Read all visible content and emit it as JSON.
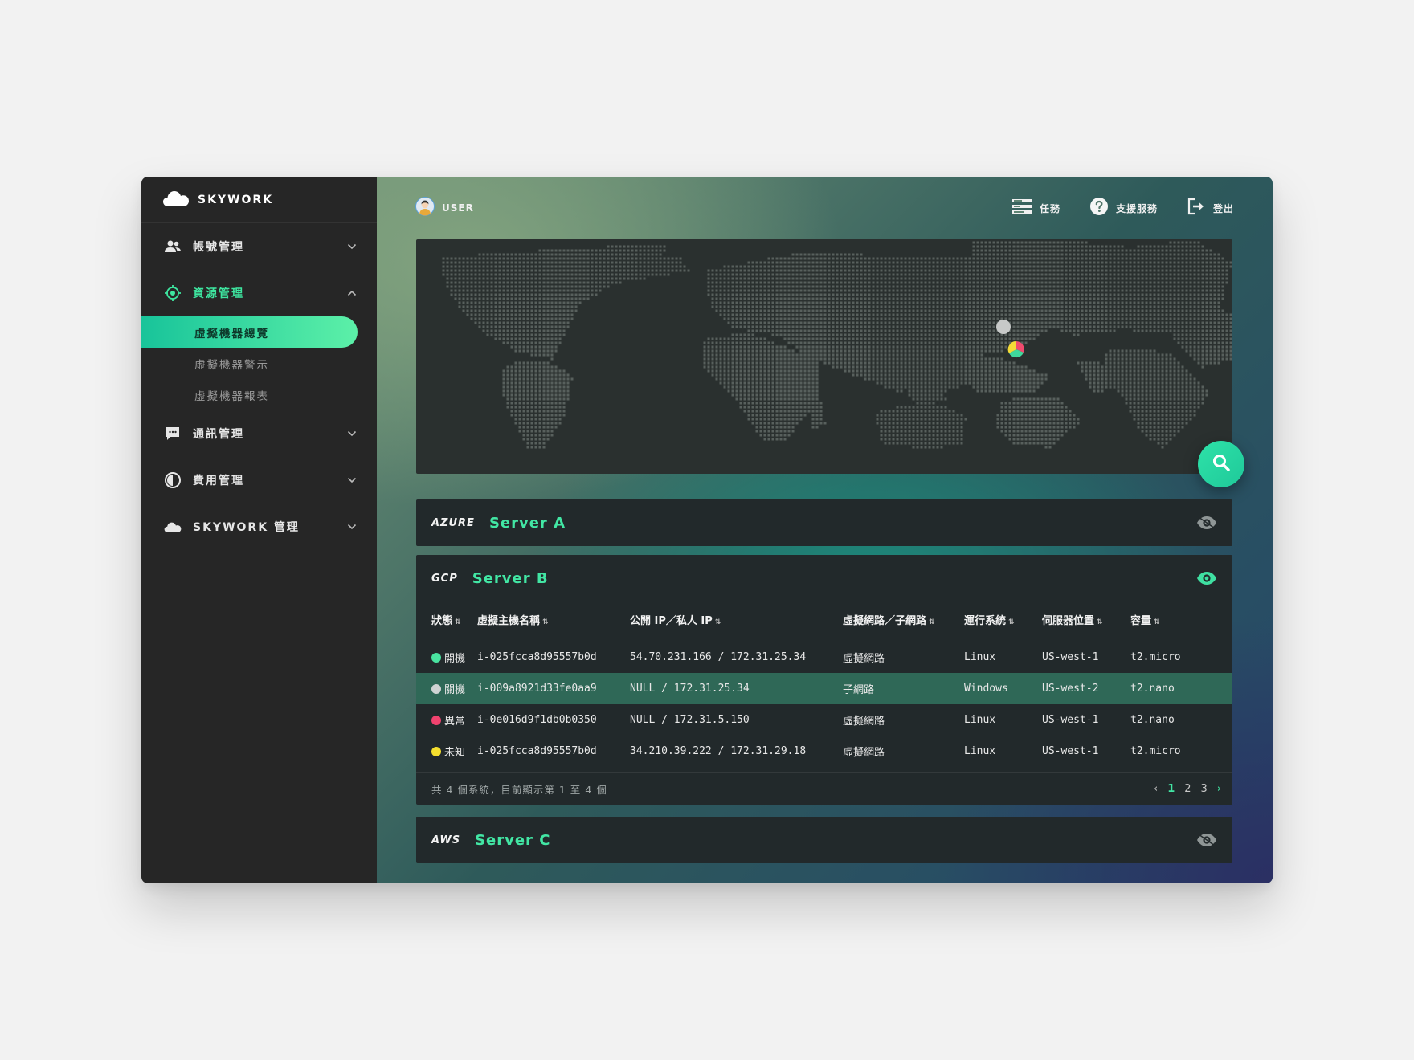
{
  "brand": {
    "name": "SKYWORK"
  },
  "sidebar": {
    "groups": [
      {
        "label": "帳號管理",
        "icon": "users-icon",
        "expanded": false
      },
      {
        "label": "資源管理",
        "icon": "target-icon",
        "expanded": true,
        "items": [
          {
            "label": "虛擬機器總覽",
            "active": true
          },
          {
            "label": "虛擬機器警示",
            "active": false
          },
          {
            "label": "虛擬機器報表",
            "active": false
          }
        ]
      },
      {
        "label": "通訊管理",
        "icon": "chat-icon",
        "expanded": false
      },
      {
        "label": "費用管理",
        "icon": "billing-icon",
        "expanded": false
      },
      {
        "label": "SKYWORK 管理",
        "icon": "cloud-icon",
        "expanded": false
      }
    ]
  },
  "topbar": {
    "user": "USER",
    "tasks": "任務",
    "support": "支援服務",
    "logout": "登出"
  },
  "servers": [
    {
      "provider": "AZURE",
      "name": "Server A",
      "visible": false
    },
    {
      "provider": "GCP",
      "name": "Server B",
      "visible": true,
      "columns": [
        "狀態",
        "虛擬主機名稱",
        "公開 IP／私人 IP",
        "虛擬網路／子網路",
        "運行系統",
        "伺服器位置",
        "容量"
      ],
      "rows": [
        {
          "status": "開機",
          "status_color": "#49e3a0",
          "host": "i-025fcca8d95557b0d",
          "ip": "54.70.231.166 / 172.31.25.34",
          "network": "虛擬網路",
          "os": "Linux",
          "location": "US-west-1",
          "size": "t2.micro",
          "highlight": false
        },
        {
          "status": "關機",
          "status_color": "#cfd3d3",
          "host": "i-009a8921d33fe0aa9",
          "ip": "NULL / 172.31.25.34",
          "network": "子網路",
          "os": "Windows",
          "location": "US-west-2",
          "size": "t2.nano",
          "highlight": true
        },
        {
          "status": "異常",
          "status_color": "#f0436f",
          "host": "i-0e016d9f1db0b0350",
          "ip": "NULL / 172.31.5.150",
          "network": "虛擬網路",
          "os": "Linux",
          "location": "US-west-1",
          "size": "t2.nano",
          "highlight": false
        },
        {
          "status": "未知",
          "status_color": "#f5df2e",
          "host": "i-025fcca8d95557b0d",
          "ip": "34.210.39.222 / 172.31.29.18",
          "network": "虛擬網路",
          "os": "Linux",
          "location": "US-west-1",
          "size": "t2.micro",
          "highlight": false
        }
      ],
      "summary": "共 4 個系統，目前顯示第 1 至 4 個",
      "pages": [
        "1",
        "2",
        "3"
      ],
      "current_page": "1"
    },
    {
      "provider": "AWS",
      "name": "Server C",
      "visible": false
    }
  ],
  "colors": {
    "accent": "#42e6a4",
    "sidebar": "#262626",
    "panel": "#22292b",
    "highlight_row": "#2f6857"
  }
}
